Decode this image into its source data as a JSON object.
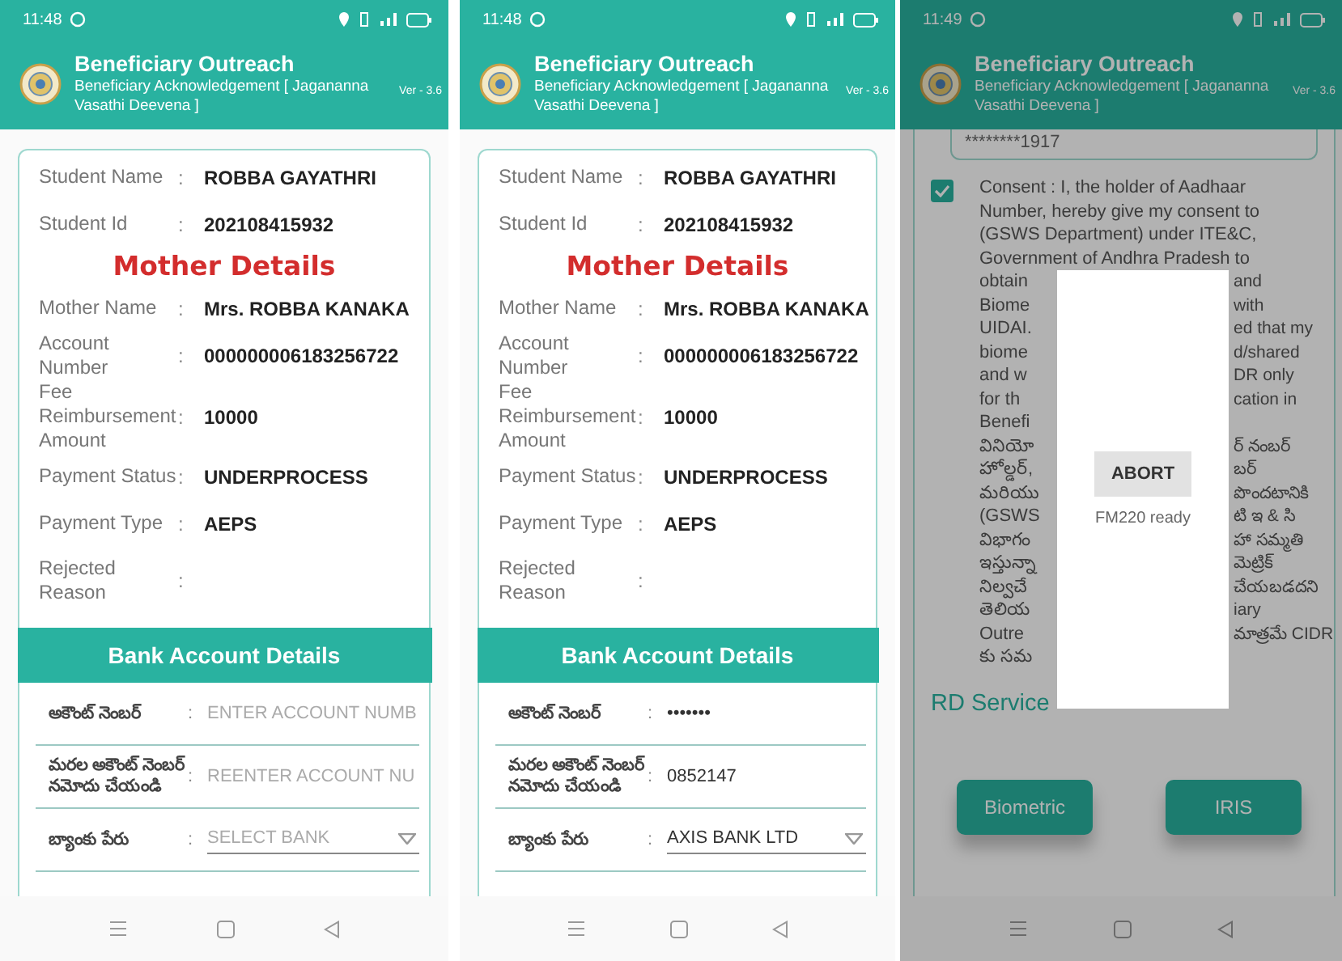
{
  "phones": [
    {
      "status_bar": {
        "time": "11:48"
      },
      "app_bar": {
        "title": "Beneficiary Outreach",
        "subtitle": "Beneficiary Acknowledgement [ Jagananna Vasathi Deevena ]",
        "version": "Ver - 3.6"
      },
      "dimmed": false,
      "screen": {
        "kind": "details",
        "rows": [
          {
            "kind": "field",
            "label": "Student Name",
            "separator": ":",
            "value": "ROBBA GAYATHRI"
          },
          {
            "kind": "field",
            "label": "Student Id",
            "separator": ":",
            "value": "202108415932"
          },
          {
            "kind": "heading",
            "text": "Mother Details"
          },
          {
            "kind": "field",
            "label": "Mother Name",
            "separator": ":",
            "value": "Mrs. ROBBA  KANAKA"
          },
          {
            "kind": "field",
            "label": "Account Number",
            "separator": ":",
            "value": "000000006183256722"
          },
          {
            "kind": "field",
            "label": "Fee Reimbursement Amount",
            "separator": ":",
            "value": "10000"
          },
          {
            "kind": "field",
            "label": "Payment Status",
            "separator": ":",
            "value": "UNDERPROCESS"
          },
          {
            "kind": "field",
            "label": "Payment Type",
            "separator": ":",
            "value": "AEPS"
          },
          {
            "kind": "field",
            "label": "Rejected Reason",
            "separator": ":"
          }
        ],
        "bank_section": {
          "title": "Bank Account Details",
          "fields": [
            {
              "kind": "text",
              "label": "అకౌంట్ నెంబర్",
              "separator": ":",
              "placeholder": "ENTER ACCOUNT NUMB"
            },
            {
              "kind": "text",
              "label": "మరల అకౌంట్ నెంబర్ నమోదు చేయండి",
              "separator": ":",
              "placeholder": "REENTER ACCOUNT NU"
            },
            {
              "kind": "select",
              "label": "బ్యాంకు పేరు",
              "separator": ":",
              "placeholder": "SELECT BANK"
            }
          ]
        }
      }
    },
    {
      "status_bar": {
        "time": "11:48"
      },
      "app_bar": {
        "title": "Beneficiary Outreach",
        "subtitle": "Beneficiary Acknowledgement [ Jagananna Vasathi Deevena ]",
        "version": "Ver - 3.6"
      },
      "dimmed": false,
      "screen": {
        "kind": "details",
        "rows": [
          {
            "kind": "field",
            "label": "Student Name",
            "separator": ":",
            "value": "ROBBA GAYATHRI"
          },
          {
            "kind": "field",
            "label": "Student Id",
            "separator": ":",
            "value": "202108415932"
          },
          {
            "kind": "heading",
            "text": "Mother Details"
          },
          {
            "kind": "field",
            "label": "Mother Name",
            "separator": ":",
            "value": "Mrs. ROBBA  KANAKA"
          },
          {
            "kind": "field",
            "label": "Account Number",
            "separator": ":",
            "value": "000000006183256722"
          },
          {
            "kind": "field",
            "label": "Fee Reimbursement Amount",
            "separator": ":",
            "value": "10000"
          },
          {
            "kind": "field",
            "label": "Payment Status",
            "separator": ":",
            "value": "UNDERPROCESS"
          },
          {
            "kind": "field",
            "label": "Payment Type",
            "separator": ":",
            "value": "AEPS"
          },
          {
            "kind": "field",
            "label": "Rejected Reason",
            "separator": ":"
          }
        ],
        "bank_section": {
          "title": "Bank Account Details",
          "fields": [
            {
              "kind": "text",
              "label": "అకౌంట్ నెంబర్",
              "separator": ":",
              "value": "•••••••"
            },
            {
              "kind": "text",
              "label": "మరల అకౌంట్ నెంబర్ నమోదు చేయండి",
              "separator": ":",
              "value": "0852147"
            },
            {
              "kind": "select",
              "label": "బ్యాంకు పేరు",
              "separator": ":",
              "value": "AXIS BANK LTD"
            }
          ]
        }
      }
    },
    {
      "status_bar": {
        "time": "11:49"
      },
      "app_bar": {
        "title": "Beneficiary Outreach",
        "subtitle": "Beneficiary Acknowledgement [ Jagananna Vasathi Deevena ]",
        "version": "Ver - 3.6"
      },
      "dimmed": true,
      "screen": {
        "kind": "consent",
        "aadhaar_field": {
          "value": "********1917"
        },
        "consent": {
          "checked": true,
          "lines": [
            {
              "kind": "full",
              "left": "Consent : I, the holder of Aadhaar"
            },
            {
              "kind": "full",
              "left": "Number, hereby give my consent to"
            },
            {
              "kind": "full",
              "left": "(GSWS Department) under ITE&C,"
            },
            {
              "kind": "full",
              "left": "Government of Andhra Pradesh to"
            },
            {
              "kind": "split",
              "left": "obtain",
              "right": "and"
            },
            {
              "kind": "split",
              "left": "Biome",
              "right": "with"
            },
            {
              "kind": "split",
              "left": "UIDAI.",
              "right": "ed that my"
            },
            {
              "kind": "split",
              "left": "biome",
              "right": "d/shared"
            },
            {
              "kind": "split",
              "left": "and w",
              "right": "DR only"
            },
            {
              "kind": "split",
              "left": "for th",
              "right": "cation in"
            },
            {
              "kind": "split",
              "left": "Benefi"
            },
            {
              "kind": "split",
              "left": "వినియో",
              "right": "ర్ నంబర్"
            },
            {
              "kind": "split",
              "left": "హోల్డర్,",
              "right": "బర్"
            },
            {
              "kind": "split",
              "left": "మరియు",
              "right": "పొందటానికి"
            },
            {
              "kind": "split",
              "left": "(GSWS",
              "right": "టి ఇ & సి"
            },
            {
              "kind": "split",
              "left": "విభాగం",
              "right": "హా సమ్మతి"
            },
            {
              "kind": "split",
              "left": "ఇస్తున్నా",
              "right": "మెట్రిక్"
            },
            {
              "kind": "split",
              "left": "నిల్వచే",
              "right": "చేయబడదని"
            },
            {
              "kind": "split",
              "left": "తెలియ",
              "right": "iary"
            },
            {
              "kind": "split",
              "left": "Outre",
              "right": "మాత్రమే CIDR"
            },
            {
              "kind": "split",
              "left": "కు సమ"
            }
          ]
        },
        "rd_service": "RD Service",
        "buttons": [
          "Biometric",
          "IRIS"
        ],
        "dialog": {
          "button": "ABORT",
          "message": "FM220 ready"
        }
      }
    }
  ]
}
